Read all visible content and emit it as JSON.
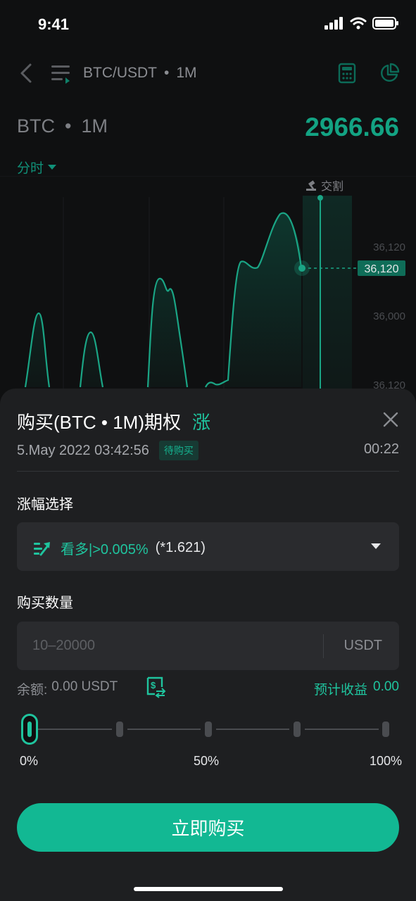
{
  "status": {
    "time": "9:41"
  },
  "header": {
    "pair": "BTC/USDT",
    "sep": "•",
    "interval": "1M"
  },
  "ticker": {
    "symbol": "BTC",
    "sep": "•",
    "interval": "1M",
    "price": "2966.66"
  },
  "chart": {
    "timeframe": "分时",
    "delivery_label": "交割",
    "current_tag": "36,120",
    "y_ticks": [
      "36,120",
      "36,000",
      "36,120"
    ]
  },
  "sheet": {
    "title": "购买(BTC • 1M)期权",
    "direction": "涨",
    "datetime": "5.May 2022 03:42:56",
    "status_badge": "待购买",
    "countdown": "00:22",
    "range_label": "涨幅选择",
    "range_option": {
      "text": "看多|>0.005%",
      "multiplier": "(*1.621)"
    },
    "amount_label": "购买数量",
    "amount_placeholder": "10–20000",
    "amount_value": "",
    "amount_unit": "USDT",
    "balance_label": "余额:",
    "balance_value": "0.00 USDT",
    "profit_label": "预计收益",
    "profit_value": "0.00",
    "slider": {
      "value": 0,
      "ticks": [
        "0%",
        "50%",
        "100%"
      ]
    },
    "buy_label": "立即购买"
  },
  "colors": {
    "accent": "#1fc49e",
    "button": "#12b893",
    "price": "#13a383"
  }
}
